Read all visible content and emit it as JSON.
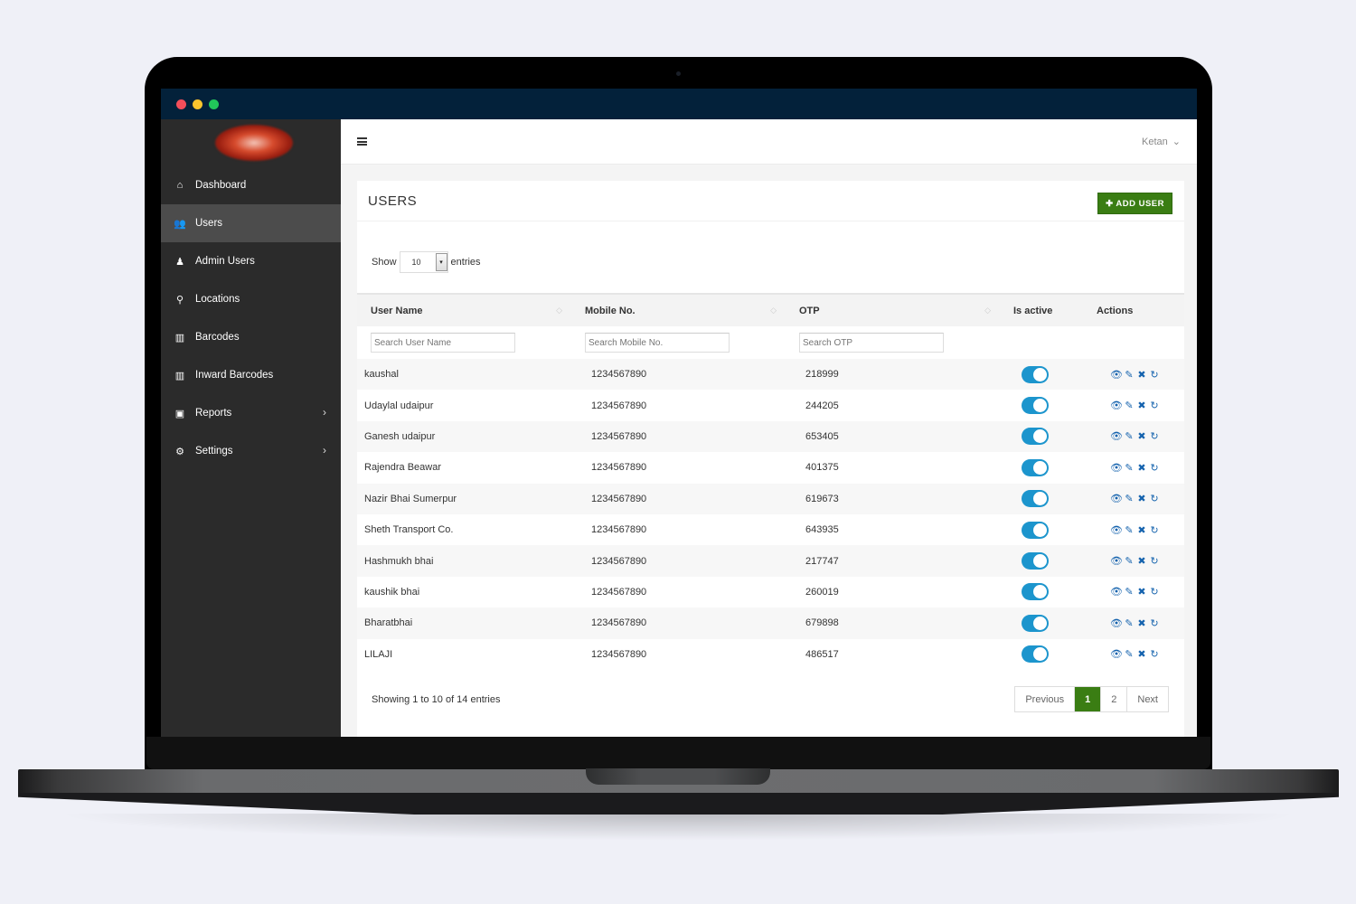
{
  "window": {
    "controls": [
      "close",
      "minimize",
      "maximize"
    ]
  },
  "sidebar": {
    "logo": "company-logo",
    "items": [
      {
        "label": "Dashboard",
        "icon": "home-icon",
        "glyph": "⌂",
        "active": false,
        "has_submenu": false
      },
      {
        "label": "Users",
        "icon": "users-icon",
        "glyph": "👥",
        "active": true,
        "has_submenu": false
      },
      {
        "label": "Admin Users",
        "icon": "user-icon",
        "glyph": "♟",
        "active": false,
        "has_submenu": false
      },
      {
        "label": "Locations",
        "icon": "map-marker-icon",
        "glyph": "⚲",
        "active": false,
        "has_submenu": false
      },
      {
        "label": "Barcodes",
        "icon": "barcode-icon",
        "glyph": "▥",
        "active": false,
        "has_submenu": false
      },
      {
        "label": "Inward Barcodes",
        "icon": "barcode-icon",
        "glyph": "▥",
        "active": false,
        "has_submenu": false
      },
      {
        "label": "Reports",
        "icon": "report-icon",
        "glyph": "▣",
        "active": false,
        "has_submenu": true
      },
      {
        "label": "Settings",
        "icon": "cogs-icon",
        "glyph": "⚙",
        "active": false,
        "has_submenu": true
      }
    ],
    "chevron": "›"
  },
  "topbar": {
    "user_name": "Ketan",
    "user_chevron": "⌄"
  },
  "page": {
    "title": "USERS",
    "add_button": "✚ ADD USER",
    "length": {
      "show_label": "Show",
      "value": "10",
      "entries_label": "entries",
      "arrow": "▾"
    }
  },
  "table": {
    "headers": [
      "User Name",
      "Mobile No.",
      "OTP",
      "Is active",
      "Actions"
    ],
    "sort_glyph": "◇",
    "filters": [
      {
        "placeholder": "Search User Name",
        "value": ""
      },
      {
        "placeholder": "Search Mobile No.",
        "value": ""
      },
      {
        "placeholder": "Search OTP",
        "value": ""
      }
    ],
    "action_glyphs": {
      "view": "👁",
      "edit": "✎",
      "delete": "✖",
      "refresh": "↻"
    },
    "rows": [
      {
        "name": "kaushal",
        "mobile": "1234567890",
        "otp": "218999",
        "active": true
      },
      {
        "name": "Udaylal udaipur",
        "mobile": "1234567890",
        "otp": "244205",
        "active": true
      },
      {
        "name": "Ganesh udaipur",
        "mobile": "1234567890",
        "otp": "653405",
        "active": true
      },
      {
        "name": "Rajendra Beawar",
        "mobile": "1234567890",
        "otp": "401375",
        "active": true
      },
      {
        "name": "Nazir Bhai Sumerpur",
        "mobile": "1234567890",
        "otp": "619673",
        "active": true
      },
      {
        "name": "Sheth Transport Co.",
        "mobile": "1234567890",
        "otp": "643935",
        "active": true
      },
      {
        "name": "Hashmukh bhai",
        "mobile": "1234567890",
        "otp": "217747",
        "active": true
      },
      {
        "name": "kaushik bhai",
        "mobile": "1234567890",
        "otp": "260019",
        "active": true
      },
      {
        "name": "Bharatbhai",
        "mobile": "1234567890",
        "otp": "679898",
        "active": true
      },
      {
        "name": "LILAJI",
        "mobile": "1234567890",
        "otp": "486517",
        "active": true
      }
    ]
  },
  "footer": {
    "info": "Showing 1 to 10 of 14 entries",
    "pagination": {
      "previous": "Previous",
      "pages": [
        "1",
        "2"
      ],
      "current": "1",
      "next": "Next"
    }
  },
  "colors": {
    "accent_green": "#3a7d13",
    "toggle_blue": "#1c95cd",
    "action_blue": "#1563ae",
    "sidebar_bg": "#2b2b2b",
    "titlebar_bg": "#03213a"
  }
}
